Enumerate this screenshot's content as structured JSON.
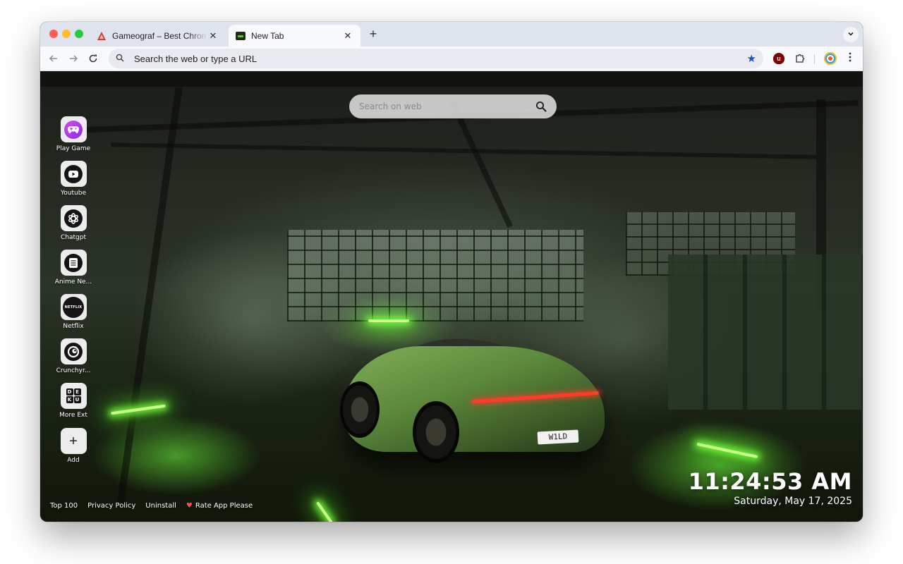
{
  "browser": {
    "tabs": [
      {
        "title": "Gameograf – Best Chrome Li",
        "favicon": "gameograf-favicon-icon",
        "active": false
      },
      {
        "title": "New Tab",
        "favicon": "newtab-favicon-icon",
        "active": true
      }
    ],
    "new_tab_symbol": "+",
    "tab_close_symbol": "✕",
    "omnibox": {
      "placeholder": "Search the web or type a URL"
    },
    "extensions": [
      "ublock-icon",
      "puzzle-icon"
    ],
    "accent_color": "#1a55c8"
  },
  "newtab": {
    "search": {
      "placeholder": "Search on web"
    },
    "shortcuts": [
      {
        "label": "Play Game",
        "icon": "gamepad-icon"
      },
      {
        "label": "Youtube",
        "icon": "youtube-icon"
      },
      {
        "label": "Chatgpt",
        "icon": "chatgpt-icon"
      },
      {
        "label": "Anime Ne...",
        "icon": "anime-news-icon"
      },
      {
        "label": "Netflix",
        "icon": "netflix-icon"
      },
      {
        "label": "Crunchyr...",
        "icon": "crunchyroll-icon"
      },
      {
        "label": "More Ext",
        "icon": "deku-grid-icon"
      },
      {
        "label": "Add",
        "icon": "plus-icon"
      }
    ],
    "netflix_text": "NETFLIX",
    "deku_letters": [
      "D",
      "E",
      "K",
      "U"
    ],
    "add_symbol": "+",
    "footer": {
      "top100": "Top 100",
      "privacy": "Privacy Policy",
      "uninstall": "Uninstall",
      "rate": "Rate App Please",
      "rate_icon": "heart-icon"
    },
    "clock": {
      "time": "11:24:53 AM",
      "date": "Saturday, May 17, 2025"
    },
    "plate_text": "W1LD"
  }
}
